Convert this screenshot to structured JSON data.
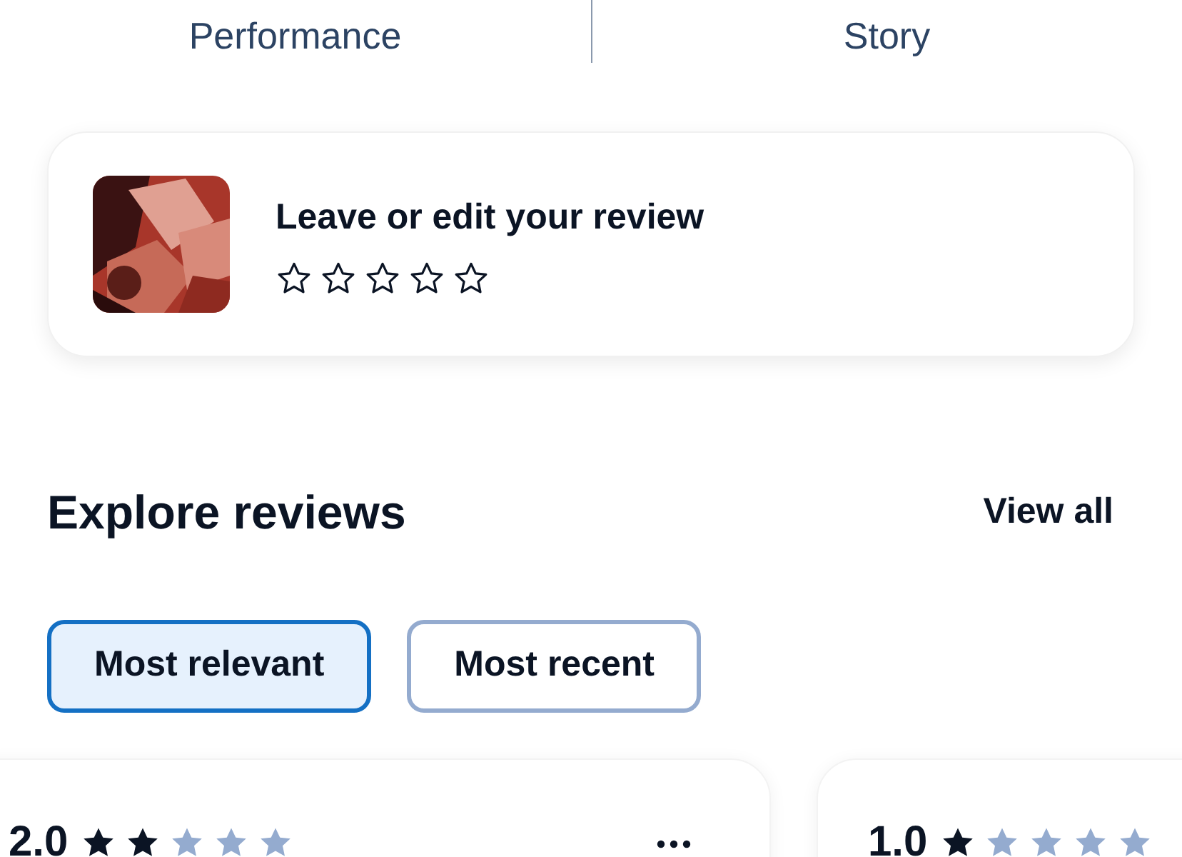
{
  "tabs": [
    {
      "label": "Performance"
    },
    {
      "label": "Story"
    }
  ],
  "review_prompt": {
    "title": "Leave or edit your review",
    "stars": 0
  },
  "explore": {
    "title": "Explore reviews",
    "link": "View all"
  },
  "filters": [
    {
      "label": "Most relevant",
      "selected": true
    },
    {
      "label": "Most recent",
      "selected": false
    }
  ],
  "reviews": [
    {
      "rating": "2.0",
      "stars": 2,
      "has_menu": true
    },
    {
      "rating": "1.0",
      "stars": 1
    }
  ]
}
